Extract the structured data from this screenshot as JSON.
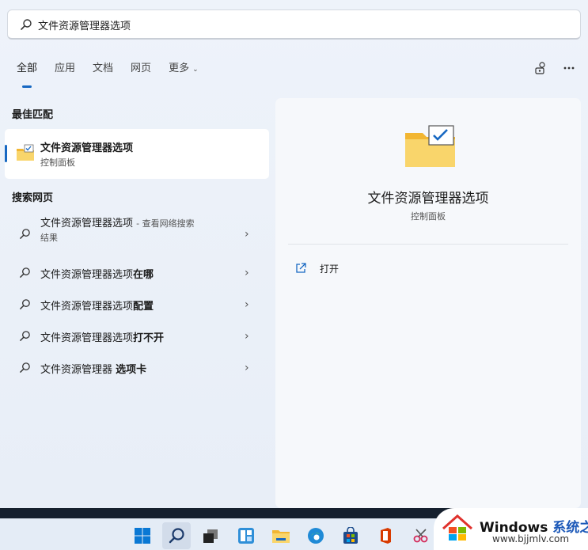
{
  "search": {
    "value": "文件资源管理器选项",
    "icon": "search-icon"
  },
  "tabs": [
    {
      "label": "全部",
      "active": true
    },
    {
      "label": "应用"
    },
    {
      "label": "文档"
    },
    {
      "label": "网页"
    },
    {
      "label": "更多"
    }
  ],
  "toolbar": {
    "share_icon": "people-icon",
    "more_icon": "more-icon"
  },
  "best_match": {
    "title": "最佳匹配",
    "name": "文件资源管理器选项",
    "sub": "控制面板"
  },
  "web_search": {
    "title": "搜索网页",
    "items": [
      {
        "main": "文件资源管理器选项",
        "hint": "- 查看网络搜索",
        "line2": "结果"
      },
      {
        "prefix": "文件资源管理器选项",
        "bold": "在哪"
      },
      {
        "prefix": "文件资源管理器选项",
        "bold": "配置"
      },
      {
        "prefix": "文件资源管理器选项",
        "bold": "打不开"
      },
      {
        "prefix": "文件资源管理器 ",
        "bold": "选项卡"
      }
    ]
  },
  "preview": {
    "name": "文件资源管理器选项",
    "sub": "控制面板",
    "action": "打开"
  },
  "taskbar": {
    "icons": [
      "windows-start-icon",
      "search-icon",
      "task-view-icon",
      "widgets-icon",
      "file-explorer-icon",
      "edge-icon",
      "store-icon",
      "office-icon",
      "snipping-icon"
    ]
  },
  "watermark": {
    "title_prefix": "Windows ",
    "title_suffix": "系统之家",
    "url": "www.bjjmlv.com"
  },
  "colors": {
    "accent": "#1768c2",
    "panel_bg": "#eef3fa",
    "preview_bg": "#f6f8fb",
    "folder": "#f7c948"
  }
}
